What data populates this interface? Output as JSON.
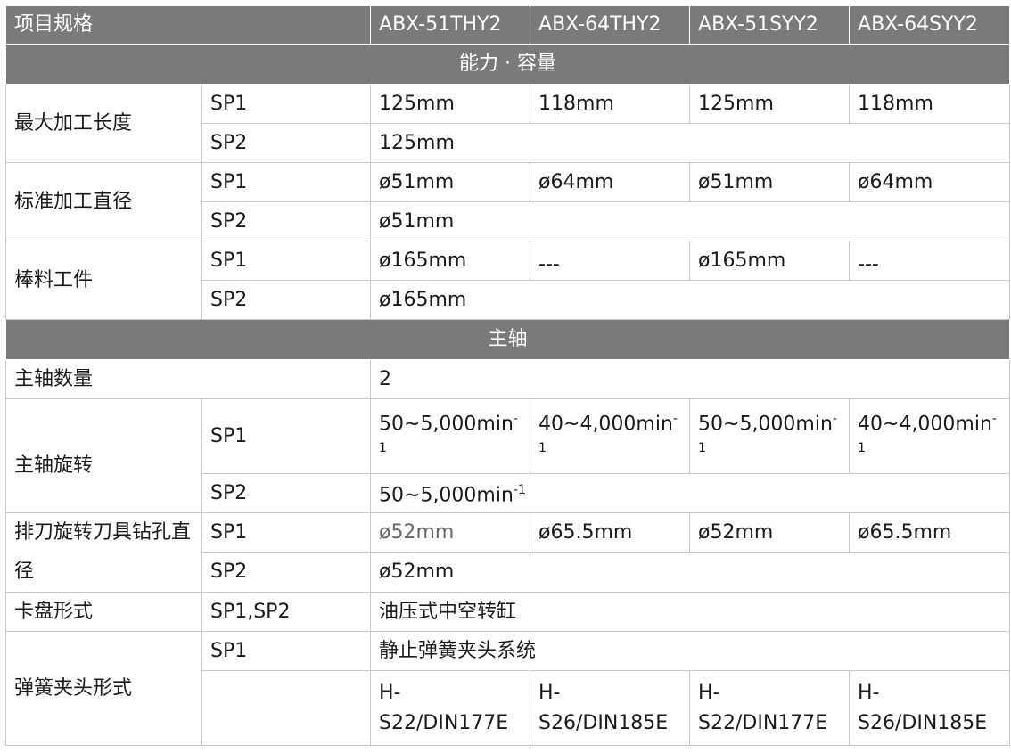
{
  "header": {
    "col1": "项目规格",
    "models": [
      "ABX-51THY2",
      "ABX-64THY2",
      "ABX-51SYY2",
      "ABX-64SYY2"
    ]
  },
  "sections": {
    "capacity": "能力 · 容量",
    "spindle": "主轴"
  },
  "rows": {
    "max_length": {
      "label": "最大加工长度",
      "sp1": "SP1",
      "sp1_values": [
        "125mm",
        "118mm",
        "125mm",
        "118mm"
      ],
      "sp2": "SP2",
      "sp2_value": "125mm"
    },
    "std_diameter": {
      "label": "标准加工直径",
      "sp1": "SP1",
      "sp1_values": [
        "ø51mm",
        "ø64mm",
        "ø51mm",
        "ø64mm"
      ],
      "sp2": "SP2",
      "sp2_value": "ø51mm"
    },
    "bar_work": {
      "label": "棒料工件",
      "sp1": "SP1",
      "sp1_values": [
        "ø165mm",
        "---",
        "ø165mm",
        "---"
      ],
      "sp2": "SP2",
      "sp2_value": "ø165mm"
    },
    "spindle_count": {
      "label": "主轴数量",
      "value": "2"
    },
    "spindle_speed": {
      "label": "主轴旋转",
      "sp1": "SP1",
      "sp1_values_main": [
        "50~5,000min",
        "40~4,000min",
        "50~5,000min",
        "40~4,000min"
      ],
      "sp1_exp_sign": "-",
      "sp1_exp_digit": "1",
      "sp2": "SP2",
      "sp2_value": "50~5,000min",
      "sp2_exp": "-1"
    },
    "gang_drill": {
      "label": "排刀旋转刀具钻孔直径",
      "sp1": "SP1",
      "sp1_values": [
        "ø52mm",
        "ø65.5mm",
        "ø52mm",
        "ø65.5mm"
      ],
      "sp2": "SP2",
      "sp2_value": "ø52mm"
    },
    "chuck_type": {
      "label": "卡盘形式",
      "sp": "SP1,SP2",
      "value": "油压式中空转缸"
    },
    "collet_type": {
      "label": "弹簧夹头形式",
      "sp1": "SP1",
      "sp1_value": "静止弹簧夹头系统",
      "sp2_prefix": "H-",
      "sp2_values": [
        "S22/DIN177E",
        "S26/DIN185E",
        "S22/DIN177E",
        "S26/DIN185E"
      ]
    }
  },
  "colors": {
    "header_bg": "#7a7a7a",
    "border": "#c9c9c9"
  }
}
